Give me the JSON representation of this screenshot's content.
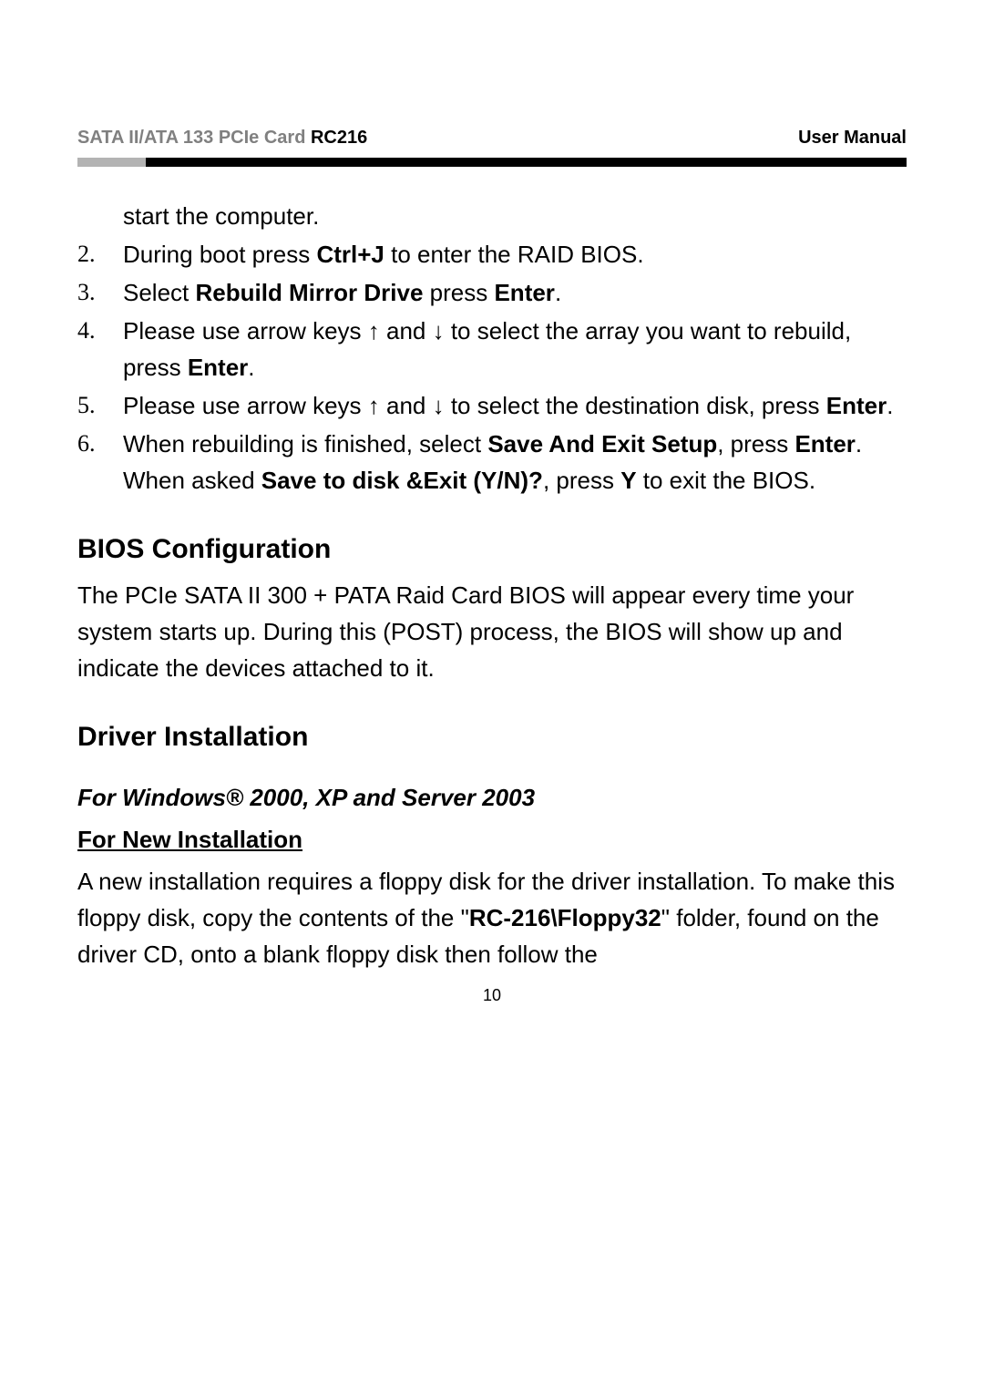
{
  "header": {
    "left_prefix": "SATA II/ATA 133 PCIe Card ",
    "left_model": "RC216",
    "right": "User Manual"
  },
  "continuation_text": "start the computer.",
  "steps": [
    {
      "num": "2.",
      "pre": "During boot press ",
      "b1": "Ctrl+J",
      "post": " to enter the RAID BIOS."
    },
    {
      "num": "3.",
      "pre": "Select ",
      "b1": "Rebuild Mirror Drive",
      "mid": " press ",
      "b2": "Enter",
      "post": "."
    },
    {
      "num": "4.",
      "pre": "Please use arrow keys  ↑  and  ↓ to select the array you want to rebuild, press ",
      "b1": "Enter",
      "post": "."
    },
    {
      "num": "5.",
      "pre": "Please use arrow keys  ↑  and  ↓ to select the destination disk, press ",
      "b1": "Enter",
      "post": "."
    },
    {
      "num": "6.",
      "pre": "When rebuilding is finished, select ",
      "b1": "Save And Exit Setup",
      "mid": ", press ",
      "b2": "Enter",
      "mid2": ". When asked ",
      "b3": "Save to disk &Exit (Y/N)?",
      "mid3": ", press ",
      "b4": "Y",
      "post": " to exit the BIOS."
    }
  ],
  "bios": {
    "heading": "BIOS Configuration",
    "body": "The PCIe SATA II 300 + PATA Raid Card BIOS will appear every time your system starts up. During this (POST) process, the BIOS will show up and indicate the devices attached to it."
  },
  "driver": {
    "heading": "Driver Installation",
    "sub_heading": "For Windows® 2000, XP and Server 2003",
    "new_install_heading": "For New Installation",
    "new_install_pre": "A new installation requires a floppy disk for the driver installation. To make this floppy disk, copy the contents of the \"",
    "new_install_bold": "RC-216\\Floppy32",
    "new_install_post": "\" folder, found on the driver CD, onto a blank floppy disk then follow the"
  },
  "page_number": "10"
}
